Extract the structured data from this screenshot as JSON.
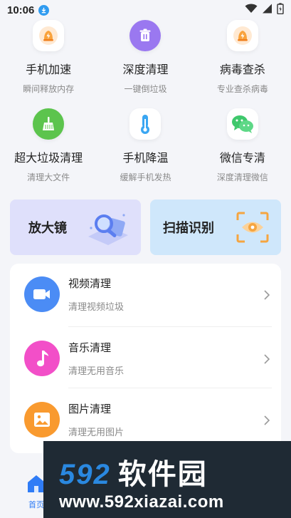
{
  "status_bar": {
    "time": "10:06"
  },
  "tools_row1": [
    {
      "title": "手机加速",
      "subtitle": "瞬间释放内存",
      "icon": "rocket-bell-icon"
    },
    {
      "title": "深度清理",
      "subtitle": "一键倒垃圾",
      "icon": "trash-icon"
    },
    {
      "title": "病毒查杀",
      "subtitle": "专业查杀病毒",
      "icon": "shield-bolt-icon"
    }
  ],
  "tools_row2": [
    {
      "title": "超大垃圾清理",
      "subtitle": "清理大文件",
      "icon": "broom-icon"
    },
    {
      "title": "手机降温",
      "subtitle": "缓解手机发热",
      "icon": "thermometer-icon"
    },
    {
      "title": "微信专清",
      "subtitle": "深度清理微信",
      "icon": "wechat-icon"
    }
  ],
  "banners": {
    "magnifier": "放大镜",
    "scan": "扫描识别"
  },
  "list": [
    {
      "title": "视频清理",
      "subtitle": "清理视频垃圾",
      "icon": "video-icon",
      "color": "#4b8cf5"
    },
    {
      "title": "音乐清理",
      "subtitle": "清理无用音乐",
      "icon": "music-note-icon",
      "color": "#f24fc8"
    },
    {
      "title": "图片清理",
      "subtitle": "清理无用图片",
      "icon": "image-icon",
      "color": "#f99a2f"
    }
  ],
  "bottom_nav": {
    "home_label": "首页"
  },
  "watermark": {
    "brand_num": "592",
    "brand_cn": "软件园",
    "url": "www.592xiazai.com"
  }
}
